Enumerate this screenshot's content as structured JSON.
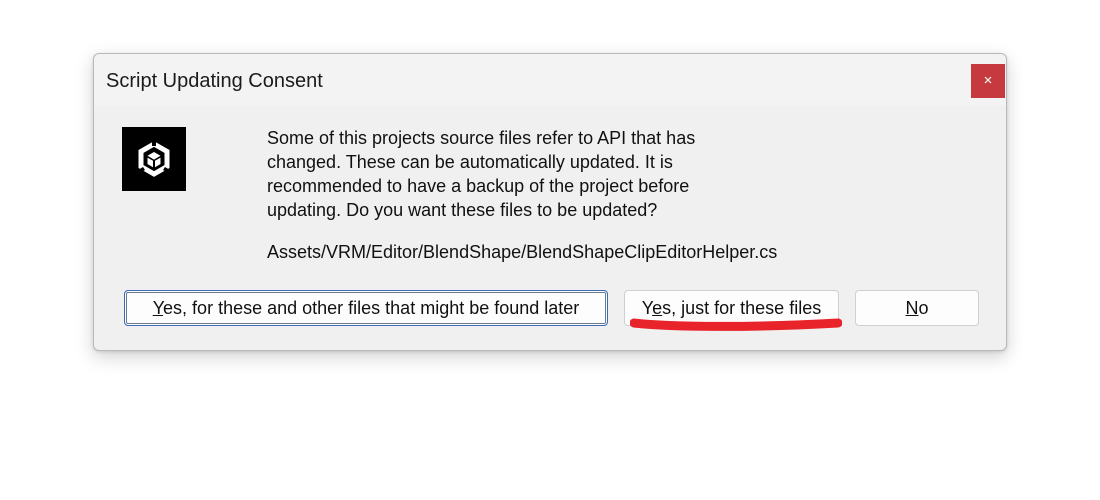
{
  "dialog": {
    "title": "Script Updating Consent",
    "close_label": "×",
    "logo_icon": "unity-logo-icon",
    "message": "Some of this projects source files refer to API that has changed. These can be automatically updated. It is recommended to have a backup of the project before updating. Do you want these files to be updated?",
    "file_path": "Assets/VRM/Editor/BlendShape/BlendShapeClipEditorHelper.cs"
  },
  "buttons": {
    "yes_all": {
      "mnemonic": "Y",
      "rest": "es, for these and other files that might be found later"
    },
    "yes_these": {
      "first": "Y",
      "mnemonic": "e",
      "rest": "s, just for these files"
    },
    "no": {
      "mnemonic": "N",
      "rest": "o"
    }
  },
  "annotation": {
    "highlight_color": "#e8232a"
  },
  "colors": {
    "close_button": "#c63a3f",
    "default_button_border": "#3b6bb5"
  }
}
